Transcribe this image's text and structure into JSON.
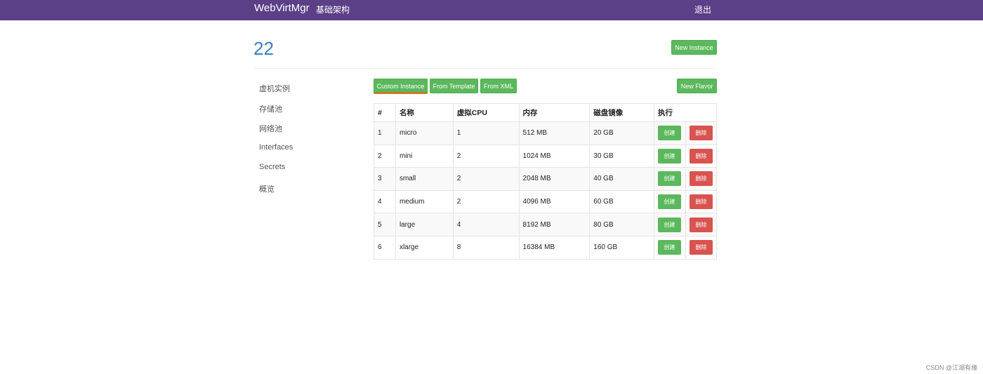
{
  "navbar": {
    "brand": "WebVirtMgr",
    "infrastructure_link": "基础架构",
    "logout_link": "退出",
    "bg_color": "#5b3f87"
  },
  "page": {
    "title": "22",
    "new_instance_button": "New Instance"
  },
  "sidebar": {
    "items": [
      {
        "label": "虚机实例"
      },
      {
        "label": "存储池"
      },
      {
        "label": "网络池"
      },
      {
        "label": "Interfaces"
      },
      {
        "label": "Secrets"
      },
      {
        "label": "概览"
      }
    ]
  },
  "toolbar": {
    "custom_instance": "Custom Instance",
    "from_template": "From Template",
    "from_xml": "From XML",
    "new_flavor": "New Flavor"
  },
  "table": {
    "headers": [
      "#",
      "名称",
      "虚拟CPU",
      "内存",
      "磁盘镜像",
      "执行"
    ],
    "rows": [
      {
        "id": "1",
        "name": "micro",
        "vcpu": "1",
        "memory": "512 MB",
        "disk": "20 GB",
        "create": "创建",
        "delete": "删除"
      },
      {
        "id": "2",
        "name": "mini",
        "vcpu": "2",
        "memory": "1024 MB",
        "disk": "30 GB",
        "create": "创建",
        "delete": "删除"
      },
      {
        "id": "3",
        "name": "small",
        "vcpu": "2",
        "memory": "2048 MB",
        "disk": "40 GB",
        "create": "创建",
        "delete": "删除"
      },
      {
        "id": "4",
        "name": "medium",
        "vcpu": "2",
        "memory": "4096 MB",
        "disk": "60 GB",
        "create": "创建",
        "delete": "删除"
      },
      {
        "id": "5",
        "name": "large",
        "vcpu": "4",
        "memory": "8192 MB",
        "disk": "80 GB",
        "create": "创建",
        "delete": "删除"
      },
      {
        "id": "6",
        "name": "xlarge",
        "vcpu": "8",
        "memory": "16384 MB",
        "disk": "160 GB",
        "create": "创建",
        "delete": "删除"
      }
    ]
  },
  "watermark": "CSDN @江湖有缘",
  "colors": {
    "success": "#5cb85c",
    "danger": "#d9534f",
    "title": "#3a7fc1"
  }
}
